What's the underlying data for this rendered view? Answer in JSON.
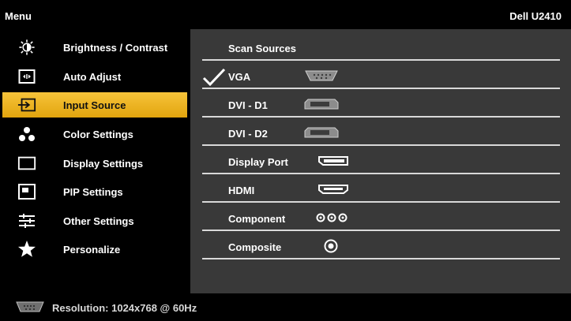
{
  "header": {
    "menu_title": "Menu",
    "model": "Dell U2410"
  },
  "sidebar": {
    "items": [
      {
        "label": "Brightness / Contrast",
        "icon": "brightness-icon"
      },
      {
        "label": "Auto Adjust",
        "icon": "auto-adjust-icon"
      },
      {
        "label": "Input Source",
        "icon": "input-source-icon",
        "active": true
      },
      {
        "label": "Color Settings",
        "icon": "color-settings-icon"
      },
      {
        "label": "Display Settings",
        "icon": "display-settings-icon"
      },
      {
        "label": "PIP Settings",
        "icon": "pip-icon"
      },
      {
        "label": "Other Settings",
        "icon": "other-settings-icon"
      },
      {
        "label": "Personalize",
        "icon": "star-icon"
      }
    ]
  },
  "panel": {
    "scan_label": "Scan Sources",
    "sources": [
      {
        "label": "VGA",
        "connector": "vga-connector-icon",
        "selected": true
      },
      {
        "label": "DVI - D1",
        "connector": "dvi-connector-icon"
      },
      {
        "label": "DVI - D2",
        "connector": "dvi-connector-icon"
      },
      {
        "label": "Display Port",
        "connector": "displayport-connector-icon"
      },
      {
        "label": "HDMI",
        "connector": "hdmi-connector-icon"
      },
      {
        "label": "Component",
        "connector": "component-connector-icon"
      },
      {
        "label": "Composite",
        "connector": "composite-connector-icon"
      }
    ]
  },
  "status": {
    "resolution": "Resolution: 1024x768 @ 60Hz"
  },
  "colors": {
    "active_bg": "#f0b72a",
    "panel_bg": "#393939",
    "divider": "#d9d9d9"
  }
}
